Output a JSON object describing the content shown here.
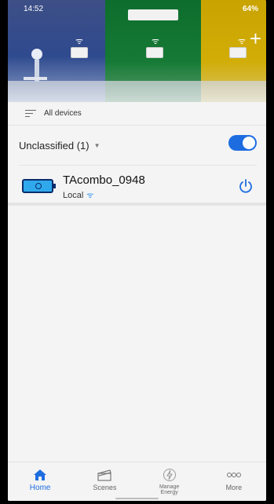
{
  "status_bar": {
    "time": "14:52",
    "right_text": "64%"
  },
  "banner": {
    "add_icon": "plus-icon"
  },
  "filter": {
    "label": "All devices",
    "icon": "filter-list-icon"
  },
  "section": {
    "label": "Unclassified (1)",
    "toggle_on": true,
    "accent": "#1e6de0"
  },
  "device": {
    "name": "TAcombo_0948",
    "connection": "Local",
    "icon": "power-strip-icon",
    "power_icon": "power-icon"
  },
  "nav": [
    {
      "label": "Home",
      "icon": "home-icon",
      "active": true
    },
    {
      "label": "Scenes",
      "icon": "clapperboard-icon",
      "active": false
    },
    {
      "label": "Manage Energy",
      "icon": "energy-icon",
      "active": false
    },
    {
      "label": "More",
      "icon": "more-dots-icon",
      "active": false
    }
  ]
}
